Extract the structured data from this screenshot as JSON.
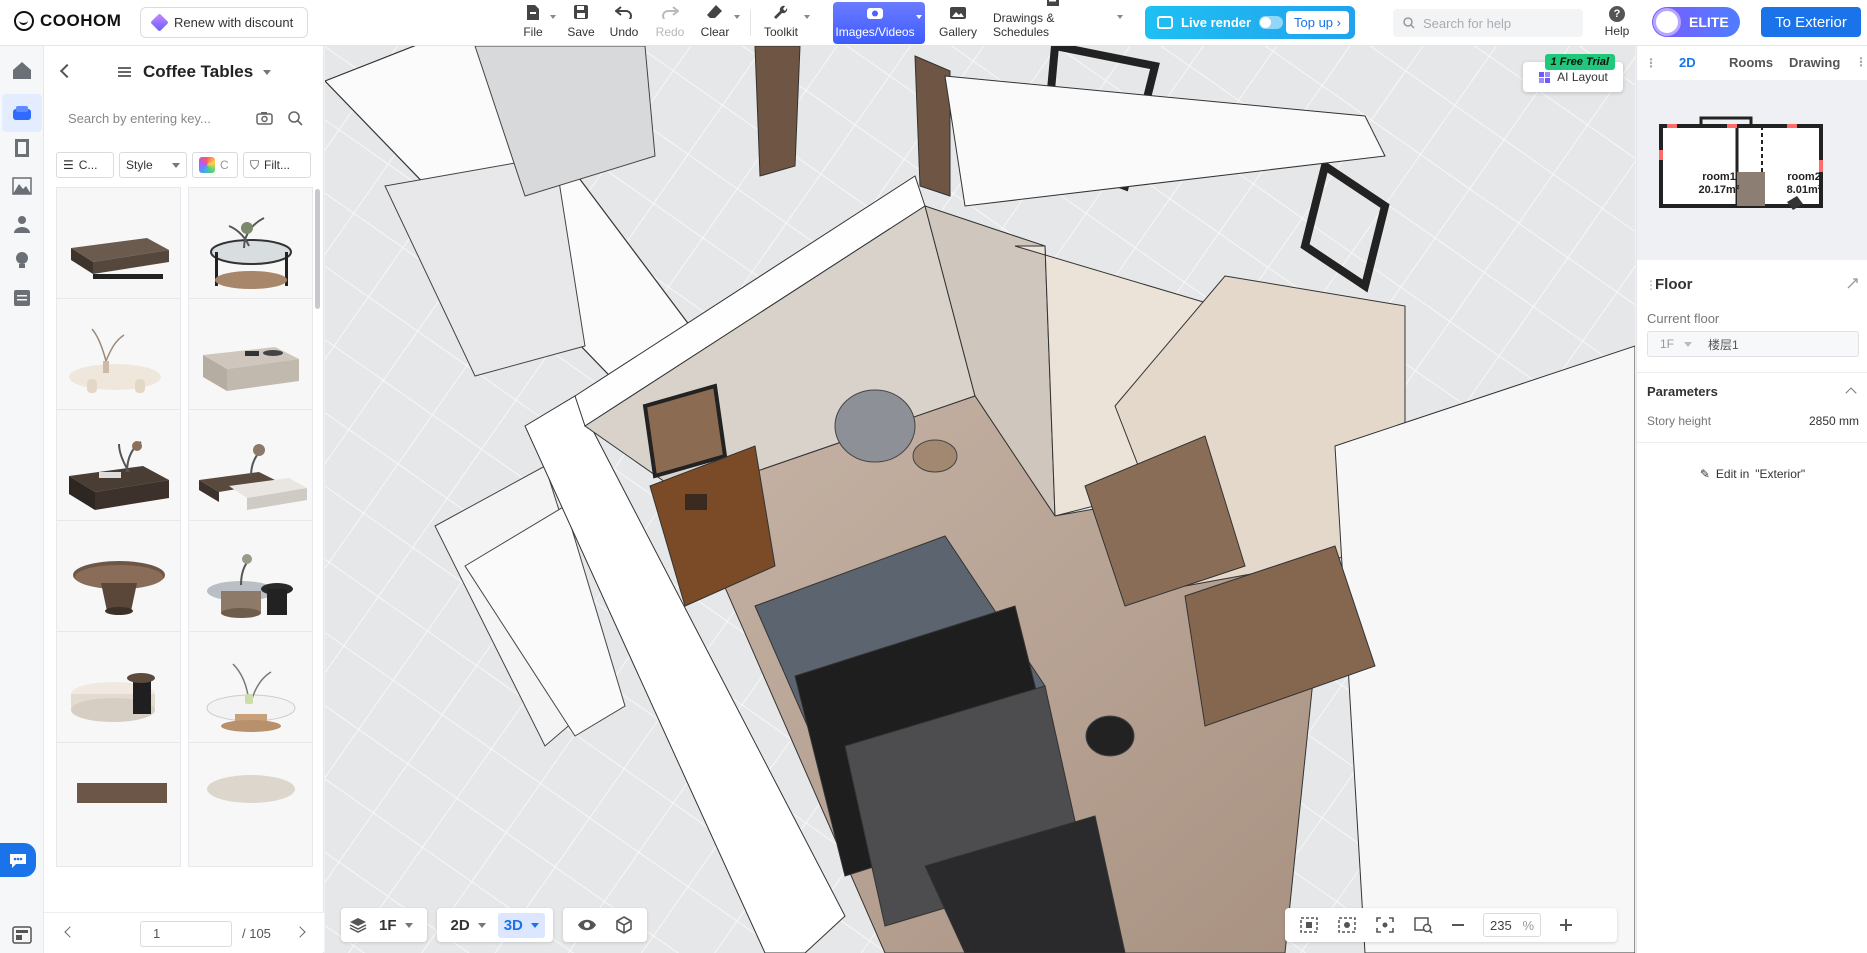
{
  "app": {
    "name": "COOHOM"
  },
  "topbar": {
    "renew": "Renew with discount",
    "tools": {
      "file": "File",
      "save": "Save",
      "undo": "Undo",
      "redo": "Redo",
      "clear": "Clear",
      "toolkit": "Toolkit",
      "images": "Images/Videos",
      "gallery": "Gallery",
      "drawings": "Drawings & Schedules"
    },
    "live_render": "Live render",
    "top_up": "Top up",
    "search_placeholder": "Search for help",
    "help": "Help",
    "elite": "ELITE",
    "to_exterior": "To Exterior"
  },
  "catalog": {
    "title": "Coffee Tables",
    "search_placeholder": "Search by entering key...",
    "filters": {
      "category": "C...",
      "style": "Style",
      "color": "C",
      "filter": "Filt..."
    },
    "page": "1",
    "total": "/ 105"
  },
  "viewport": {
    "ai_layout": "AI Layout",
    "free_trial": "1 Free Trial",
    "floor": "1F",
    "mode_2d": "2D",
    "mode_3d": "3D",
    "zoom": "235",
    "zoom_unit": "%"
  },
  "right_panel": {
    "tabs": [
      "2D",
      "Rooms",
      "Drawing"
    ],
    "minimap": {
      "room1": "room1",
      "room1_area": "20.17m²",
      "room2": "room2",
      "room2_area": "8.01m²"
    },
    "floor_title": "Floor",
    "current_floor_label": "Current floor",
    "current_floor_code": "1F",
    "current_floor_name": "楼层1",
    "parameters": "Parameters",
    "story_height_label": "Story height",
    "story_height_value": "2850 mm",
    "edit_in": "Edit in",
    "edit_target": "\"Exterior\""
  },
  "colors": {
    "accent": "#1a73e8",
    "live_render": "#1ec0f2",
    "elite": "#7a5cff",
    "trial": "#1fc87b"
  }
}
